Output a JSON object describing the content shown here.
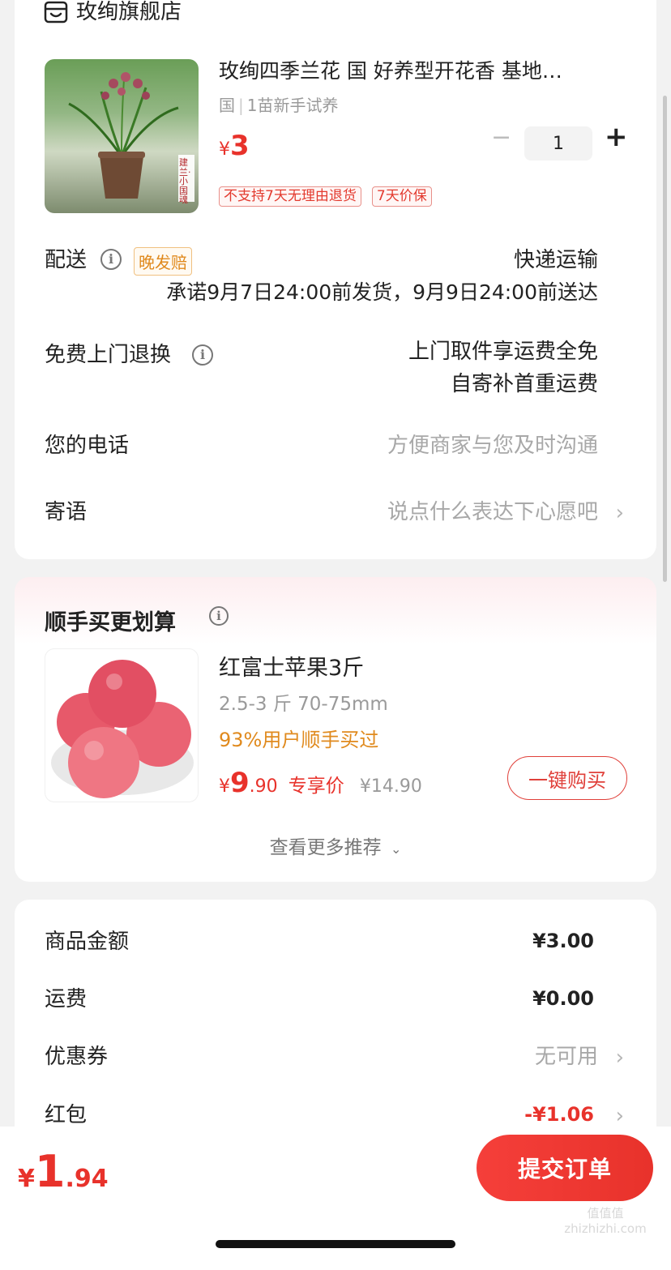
{
  "shop": {
    "name": "玫绚旗舰店",
    "icon": "store-icon"
  },
  "product": {
    "title": "玫绚四季兰花 国  好养型开花香 基地…",
    "spec_prefix": "国",
    "spec": "1苗新手试养",
    "currency": "¥",
    "price": "3",
    "quantity": "1",
    "minus": "−",
    "plus": "+",
    "tags": [
      "不支持7天无理由退货",
      "7天价保"
    ],
    "image_caption": "建兰·小国魂"
  },
  "delivery": {
    "label": "配送",
    "badge": "晚发赔",
    "method": "快递运输",
    "promise": "承诺9月7日24:00前发货，9月9日24:00前送达"
  },
  "return_service": {
    "label": "免费上门退换",
    "line1": "上门取件享运费全免",
    "line2": "自寄补首重运费"
  },
  "phone": {
    "label": "您的电话",
    "placeholder": "方便商家与您及时沟通"
  },
  "message": {
    "label": "寄语",
    "placeholder": "说点什么表达下心愿吧"
  },
  "recommend": {
    "title": "顺手买更划算",
    "item": {
      "name": "红富士苹果3斤",
      "spec": "2.5-3 斤 70-75mm",
      "social": "93%用户顺手买过",
      "currency": "¥",
      "price_int": "9",
      "price_dec": ".90",
      "price_note": "专享价",
      "original_price": "¥14.90",
      "buy_label": "一键购买"
    },
    "more": "查看更多推荐"
  },
  "summary": {
    "rows": [
      {
        "label": "商品金额",
        "value": "¥3.00"
      },
      {
        "label": "运费",
        "value": "¥0.00"
      },
      {
        "label": "优惠券",
        "value": "无可用"
      },
      {
        "label": "红包",
        "value": "-¥1.06"
      }
    ]
  },
  "footer": {
    "currency": "¥",
    "total_int": "1",
    "total_dec": ".94",
    "submit_label": "提交订单"
  },
  "watermark": "值值值 zhizhizhi.com",
  "colors": {
    "accent": "#e8322b",
    "orange_text": "#e08a1e",
    "background": "#f2f2f2"
  }
}
